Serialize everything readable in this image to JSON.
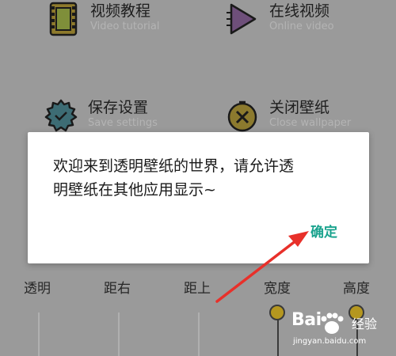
{
  "menu": {
    "video_tutorial": {
      "title": "视频教程",
      "subtitle": "Video tutorial"
    },
    "online_video": {
      "title": "在线视频",
      "subtitle": "Online video"
    },
    "save_settings": {
      "title": "保存设置",
      "subtitle": "Save settings"
    },
    "close_wallpaper": {
      "title": "关闭壁纸",
      "subtitle": "Close wallpaper"
    }
  },
  "sliders": {
    "labels": [
      "透明",
      "距右",
      "距上",
      "宽度",
      "高度"
    ],
    "width_value": 1.0,
    "height_value": 1.0
  },
  "dialog": {
    "message_line1": "欢迎来到透明壁纸的世界，请允许透",
    "message_line2": "明壁纸在其他应用显示~",
    "confirm_label": "确定"
  },
  "watermark": {
    "brand_left": "Bai",
    "brand_right": "经验",
    "url": "jingyan.baidu.com"
  },
  "colors": {
    "accent": "#1aa38e",
    "annotation": "#e8302a",
    "knob": "#b5971f"
  }
}
